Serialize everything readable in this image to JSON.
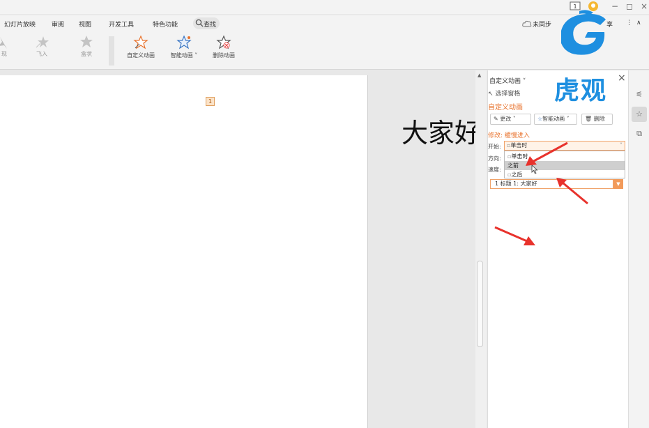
{
  "window": {
    "slide_count_icon": "slide-count-icon",
    "minimize": "−",
    "restore": "◻",
    "close": "×"
  },
  "menu": {
    "items": [
      "幻灯片放映",
      "审阅",
      "视图",
      "开发工具",
      "特色功能"
    ],
    "search": "查找",
    "sync": "未同步",
    "share": "享",
    "more": "⋮",
    "collapse": "∧"
  },
  "ribbon": {
    "faded_buttons": [
      {
        "label": "现",
        "icon": "star-icon"
      },
      {
        "label": "飞入",
        "icon": "fly-in-star-icon"
      },
      {
        "label": "盒状",
        "icon": "box-star-icon"
      }
    ],
    "buttons": [
      {
        "label": "自定义动画",
        "icon": "custom-animation-icon"
      },
      {
        "label": "智能动画",
        "icon": "smart-animation-icon",
        "has_dropdown": true
      },
      {
        "label": "删除动画",
        "icon": "delete-animation-icon"
      }
    ]
  },
  "slide": {
    "marker": "1",
    "title_text": "大家好"
  },
  "watermark": {
    "text": "虎观",
    "primary_color": "#1e8fe0"
  },
  "panel": {
    "title": "自定义动画",
    "close": "×",
    "select_pane": "选择窗格",
    "heading": "自定义动画",
    "change_button": "更改",
    "smart_button": "智能动画",
    "delete_button": "删除",
    "modify_label": "修改: 缓慢进入",
    "start_label": "开始:",
    "direction_label": "方向:",
    "speed_label": "速度:",
    "start_value": "单击时",
    "dropdown_options": [
      "单击时",
      "之前",
      "之后"
    ],
    "selected_option_index": 1,
    "anim_item": "1  标题 1: 大家好",
    "accent_color": "#e8722c"
  },
  "sidebar_tools": [
    "sliders-icon",
    "animation-star-icon",
    "copy-icon"
  ],
  "annotation_color": "#e8322c"
}
